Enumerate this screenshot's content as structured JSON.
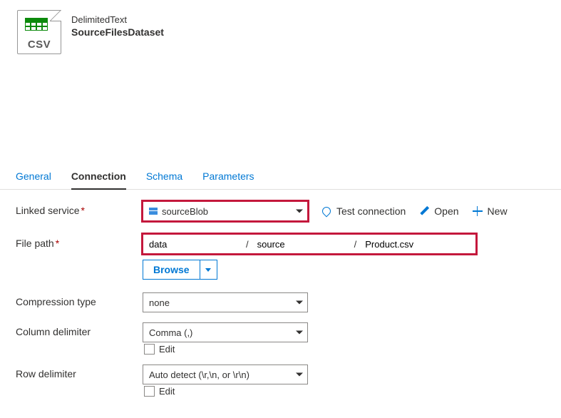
{
  "header": {
    "icon_label": "CSV",
    "dataset_type": "DelimitedText",
    "dataset_name": "SourceFilesDataset"
  },
  "tabs": {
    "general": "General",
    "connection": "Connection",
    "schema": "Schema",
    "parameters": "Parameters"
  },
  "labels": {
    "linked_service": "Linked service",
    "file_path": "File path",
    "compression_type": "Compression type",
    "column_delimiter": "Column delimiter",
    "row_delimiter": "Row delimiter"
  },
  "actions": {
    "test_connection": "Test connection",
    "open": "Open",
    "new": "New",
    "browse": "Browse",
    "edit": "Edit"
  },
  "values": {
    "linked_service": "sourceBlob",
    "file_path": {
      "container": "data",
      "directory": "source",
      "file": "Product.csv",
      "sep": "/"
    },
    "compression_type": "none",
    "column_delimiter": "Comma (,)",
    "row_delimiter": "Auto detect (\\r,\\n, or \\r\\n)"
  },
  "colors": {
    "highlight": "#c4183c",
    "link": "#0078d4"
  },
  "required_marker": "*"
}
